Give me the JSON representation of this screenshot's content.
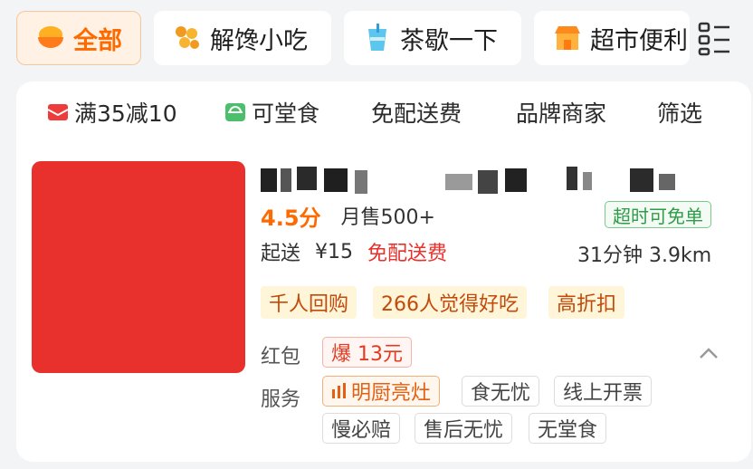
{
  "categories": [
    {
      "label": "全部",
      "icon": "bowl-icon",
      "active": true
    },
    {
      "label": "解馋小吃",
      "icon": "snack-skewer-icon",
      "active": false
    },
    {
      "label": "茶歇一下",
      "icon": "tea-cup-icon",
      "active": false
    },
    {
      "label": "超市便利",
      "icon": "store-icon",
      "active": false
    }
  ],
  "category_menu_icon": "list-menu-icon",
  "filters": [
    {
      "label": "满35减10",
      "icon": "coupon-icon"
    },
    {
      "label": "可堂食",
      "icon": "dine-in-icon"
    },
    {
      "label": "免配送费",
      "icon": ""
    },
    {
      "label": "品牌商家",
      "icon": ""
    },
    {
      "label": "筛选",
      "icon": ""
    }
  ],
  "store": {
    "rating": "4.5分",
    "monthly_sales": "月售500+",
    "overtime_badge": "超时可免单",
    "min_order_label": "起送",
    "min_order_price": "¥15",
    "free_delivery": "免配送费",
    "eta": "31分钟 3.9km",
    "highlights": [
      "千人回购",
      "266人觉得好吃",
      "高折扣"
    ],
    "red_packet_label": "红包",
    "red_packet_value": "爆 13元",
    "service_label": "服务",
    "services": [
      "明厨亮灶",
      "食无忧",
      "线上开票",
      "慢必赔",
      "售后无忧",
      "无堂食"
    ]
  },
  "colors": {
    "accent": "#ff6a00",
    "price_red": "#e8312c",
    "green_badge": "#2e9c48",
    "thumbnail": "#e8302c"
  }
}
